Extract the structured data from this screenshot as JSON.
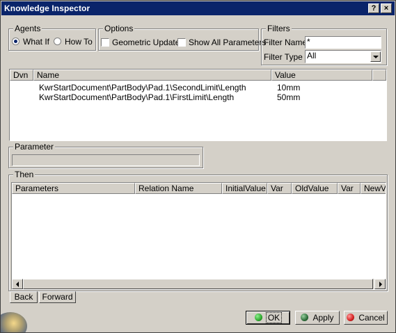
{
  "window": {
    "title": "Knowledge Inspector",
    "help_label": "?",
    "close_label": "×"
  },
  "agents": {
    "legend": "Agents",
    "what_if": "What If",
    "how_to": "How To",
    "selected": "What If"
  },
  "options": {
    "legend": "Options",
    "geometric_update": "Geometric Update",
    "show_all_parameters": "Show All Parameters"
  },
  "filters": {
    "legend": "Filters",
    "name_label": "Filter Name :",
    "name_value": "*",
    "type_label": "Filter Type :",
    "type_value": "All"
  },
  "list": {
    "columns": [
      "Dvn",
      "Name",
      "Value"
    ],
    "rows": [
      {
        "dvn": "",
        "name": "KwrStartDocument\\PartBody\\Pad.1\\SecondLimit\\Length",
        "value": "10mm"
      },
      {
        "dvn": "",
        "name": "KwrStartDocument\\PartBody\\Pad.1\\FirstLimit\\Length",
        "value": "50mm"
      }
    ]
  },
  "parameter": {
    "legend": "Parameter",
    "value": ""
  },
  "then": {
    "legend": "Then",
    "columns": [
      "Parameters",
      "Relation Name",
      "InitialValue",
      "Var",
      "OldValue",
      "Var",
      "NewV"
    ]
  },
  "nav": {
    "back": "Back",
    "forward": "Forward"
  },
  "footer": {
    "ok": "OK",
    "apply": "Apply",
    "cancel": "Cancel"
  },
  "colors": {
    "titlebar": "#0a246a",
    "face": "#d4d0c8",
    "ok_dot": "#2ea82e",
    "apply_dot": "#2e6e3a",
    "cancel_dot": "#d42020"
  }
}
